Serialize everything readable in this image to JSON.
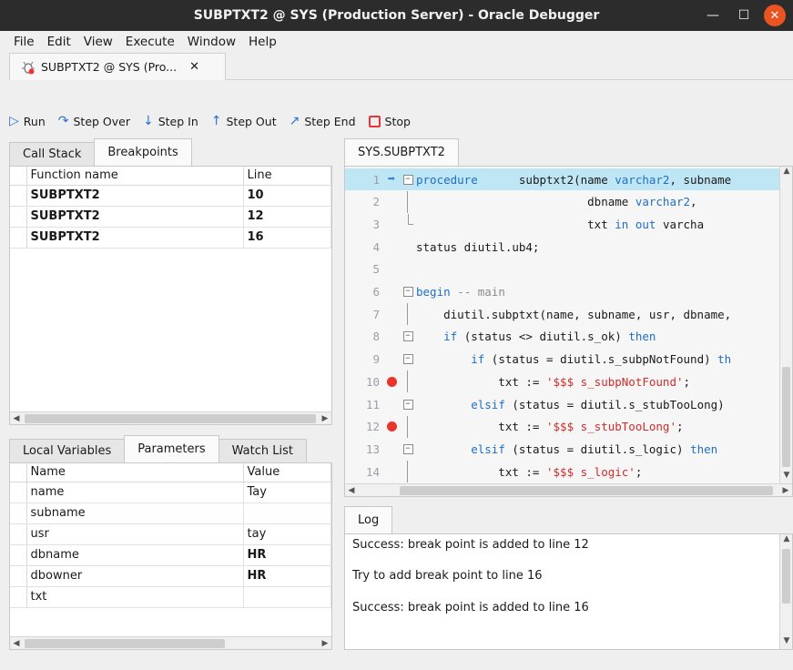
{
  "window": {
    "title": "SUBPTXT2 @ SYS (Production Server) - Oracle Debugger"
  },
  "menu": [
    "File",
    "Edit",
    "View",
    "Execute",
    "Window",
    "Help"
  ],
  "doc_tab": {
    "label": "SUBPTXT2 @ SYS (Pro...",
    "close": "✕"
  },
  "toolbar": {
    "run": "Run",
    "step_over": "Step Over",
    "step_in": "Step In",
    "step_out": "Step Out",
    "step_end": "Step End",
    "stop": "Stop"
  },
  "top_left": {
    "tabs": [
      "Call Stack",
      "Breakpoints"
    ],
    "active_tab": "Breakpoints",
    "columns": [
      "Function name",
      "Line"
    ],
    "rows": [
      {
        "function": "SUBPTXT2",
        "line": "10"
      },
      {
        "function": "SUBPTXT2",
        "line": "12"
      },
      {
        "function": "SUBPTXT2",
        "line": "16"
      }
    ]
  },
  "bottom_left": {
    "tabs": [
      "Local Variables",
      "Parameters",
      "Watch List"
    ],
    "active_tab": "Parameters",
    "columns": [
      "Name",
      "Value"
    ],
    "rows": [
      {
        "name": "name",
        "value": "Tay"
      },
      {
        "name": "subname",
        "value": ""
      },
      {
        "name": "usr",
        "value": "tay"
      },
      {
        "name": "dbname",
        "value": "HR"
      },
      {
        "name": "dbowner",
        "value": "HR"
      },
      {
        "name": "txt",
        "value": ""
      }
    ]
  },
  "editor": {
    "tab": "SYS.SUBPTXT2",
    "current_line": 1,
    "breakpoint_lines": [
      10,
      12
    ],
    "lines": [
      {
        "n": "1",
        "text": "procedure      subptxt2(name varchar2, subname"
      },
      {
        "n": "2",
        "text": "                         dbname varchar2,"
      },
      {
        "n": "3",
        "text": "                         txt in out varcha"
      },
      {
        "n": "4",
        "text": "status diutil.ub4;"
      },
      {
        "n": "5",
        "text": ""
      },
      {
        "n": "6",
        "text": "begin -- main"
      },
      {
        "n": "7",
        "text": "    diutil.subptxt(name, subname, usr, dbname,"
      },
      {
        "n": "8",
        "text": "    if (status <> diutil.s_ok) then"
      },
      {
        "n": "9",
        "text": "        if (status = diutil.s_subpNotFound) th"
      },
      {
        "n": "10",
        "text": "            txt := '$$$ s_subpNotFound';"
      },
      {
        "n": "11",
        "text": "        elsif (status = diutil.s_stubTooLong)"
      },
      {
        "n": "12",
        "text": "            txt := '$$$ s_stubTooLong';"
      },
      {
        "n": "13",
        "text": "        elsif (status = diutil.s_logic) then"
      },
      {
        "n": "14",
        "text": "            txt := '$$$ s_logic';"
      }
    ]
  },
  "log": {
    "tab": "Log",
    "lines": [
      "Success: break point is added to line 12",
      "Try to add break point to line 16",
      "Success: break point is added to line 16"
    ]
  },
  "colors": {
    "titlebar": "#2c2c2c",
    "close_button": "#e95420",
    "current_line": "#bfe6f5",
    "breakpoint": "#e8352b",
    "keyword": "#1f6fc5",
    "string": "#d22b2b"
  }
}
